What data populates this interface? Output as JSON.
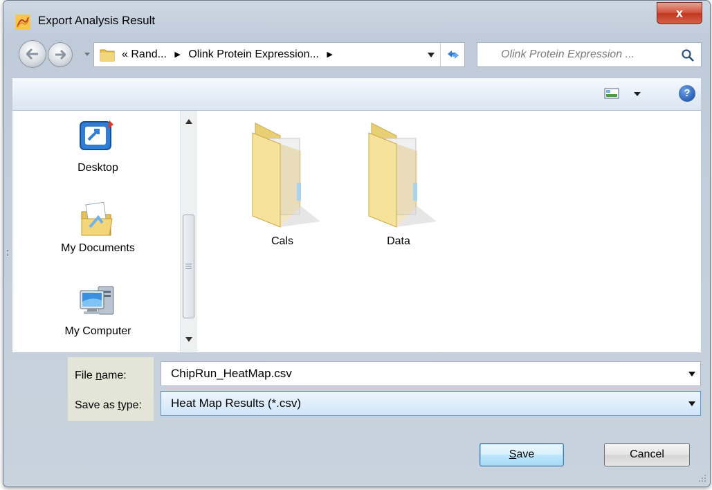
{
  "window": {
    "title": "Export Analysis Result",
    "close_label": "x"
  },
  "navigation": {
    "address_root": "«",
    "address_segments": [
      "Rand...",
      "Olink Protein Expression..."
    ],
    "search_placeholder": "Olink Protein Expression ..."
  },
  "toolbar": {
    "help_label": "?"
  },
  "sidebar": {
    "items": [
      {
        "label": "Desktop",
        "icon": "desktop-icon"
      },
      {
        "label": "My Documents",
        "icon": "my-documents-icon"
      },
      {
        "label": "My Computer",
        "icon": "my-computer-icon"
      }
    ],
    "side_mark": ":"
  },
  "content": {
    "folders": [
      {
        "name": "Cals",
        "icon": "folder-icon"
      },
      {
        "name": "Data",
        "icon": "folder-icon"
      }
    ]
  },
  "form": {
    "file_name_label_pre": "File ",
    "file_name_label_accel": "n",
    "file_name_label_post": "ame:",
    "file_name_value": "ChipRun_HeatMap.csv",
    "save_type_label_pre": "Save as ",
    "save_type_label_accel": "t",
    "save_type_label_post": "ype:",
    "save_type_value": "Heat Map Results (*.csv)"
  },
  "buttons": {
    "save_accel": "S",
    "save_rest": "ave",
    "cancel": "Cancel"
  },
  "colors": {
    "accent": "#5a98d3",
    "close_red": "#c1361f",
    "folder_yellow": "#f3dc8a"
  }
}
